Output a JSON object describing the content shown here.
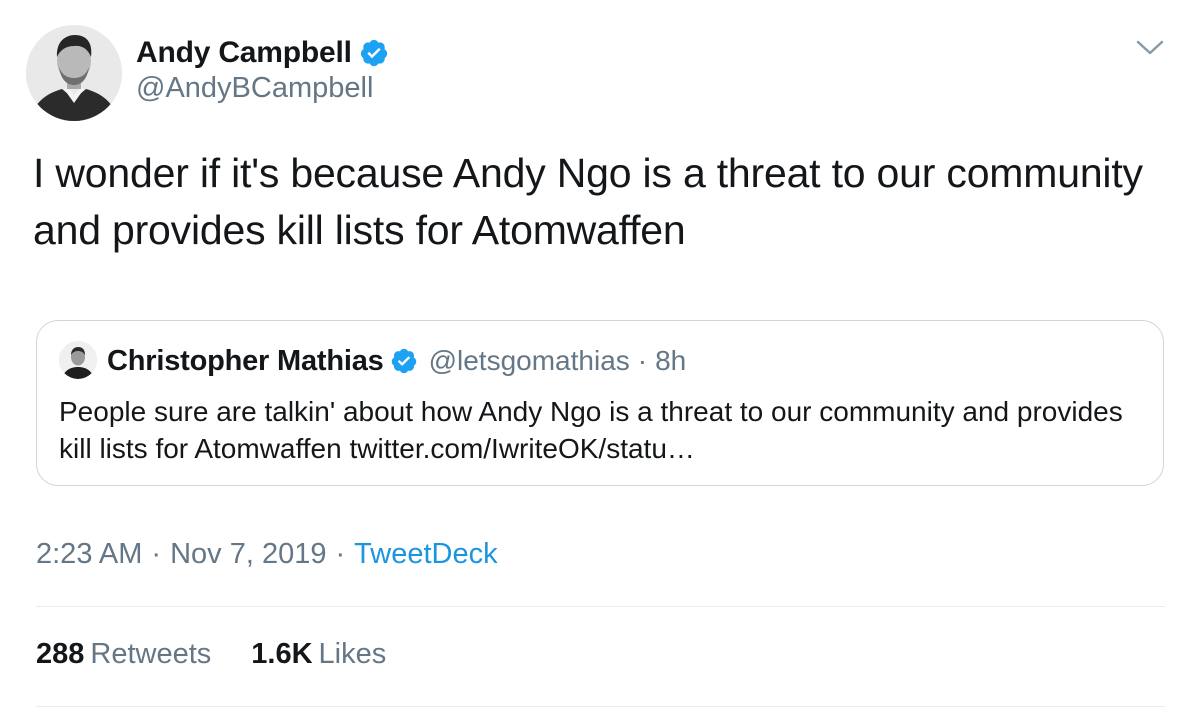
{
  "tweet": {
    "author": {
      "name": "Andy Campbell",
      "handle": "@AndyBCampbell",
      "verified": true,
      "avatar_icon": "profile-photo"
    },
    "text": "I wonder if it's because Andy Ngo is a threat to our community and provides kill lists for Atomwaffen",
    "quoted": {
      "name": "Christopher Mathias",
      "handle": "@letsgomathias",
      "separator": "·",
      "time": "8h",
      "text": "People sure are talkin' about how Andy Ngo is a threat to our community and provides kill lists for Atomwaffen twitter.com/IwriteOK/statu…",
      "verified": true
    },
    "timestamp": {
      "time": "2:23 AM",
      "separator": "·",
      "date": "Nov 7, 2019",
      "source": "TweetDeck"
    },
    "stats": {
      "retweets_count": "288",
      "retweets_label": "Retweets",
      "likes_count": "1.6K",
      "likes_label": "Likes"
    }
  },
  "colors": {
    "verified_blue": "#1da1f2",
    "link_blue": "#1b95e0",
    "secondary_text": "#657786",
    "border": "#ccd6dd"
  }
}
